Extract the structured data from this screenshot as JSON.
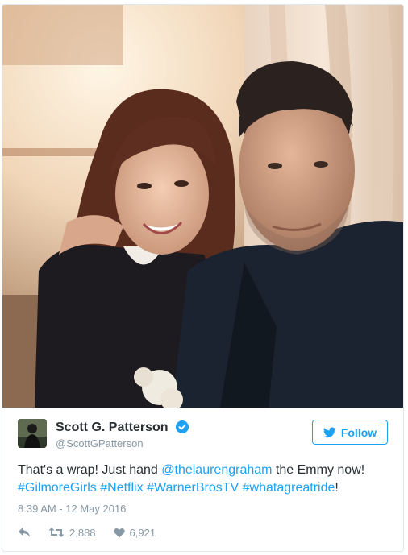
{
  "tweet": {
    "author_name": "Scott G. Patterson",
    "author_handle": "@ScottGPatterson",
    "follow_label": "Follow",
    "text_parts": {
      "intro": "That's a wrap! Just hand ",
      "mention": "@thelaurengraham",
      "middle": " the Emmy now!",
      "hashtag1": "#GilmoreGirls",
      "hashtag2": "#Netflix",
      "hashtag3": "#WarnerBrosTV",
      "hashtag4": "#whatagreatride",
      "ending": "!"
    },
    "timestamp": "8:39 AM - 12 May 2016",
    "retweet_count": "2,888",
    "like_count": "6,921"
  },
  "icons": {
    "verified": "verified-badge-icon",
    "bird": "twitter-bird-icon",
    "reply": "reply-icon",
    "retweet": "retweet-icon",
    "like": "heart-icon"
  },
  "colors": {
    "accent": "#1da1f2",
    "text": "#292f33",
    "muted": "#8899a6",
    "border": "#e1e8ed"
  }
}
